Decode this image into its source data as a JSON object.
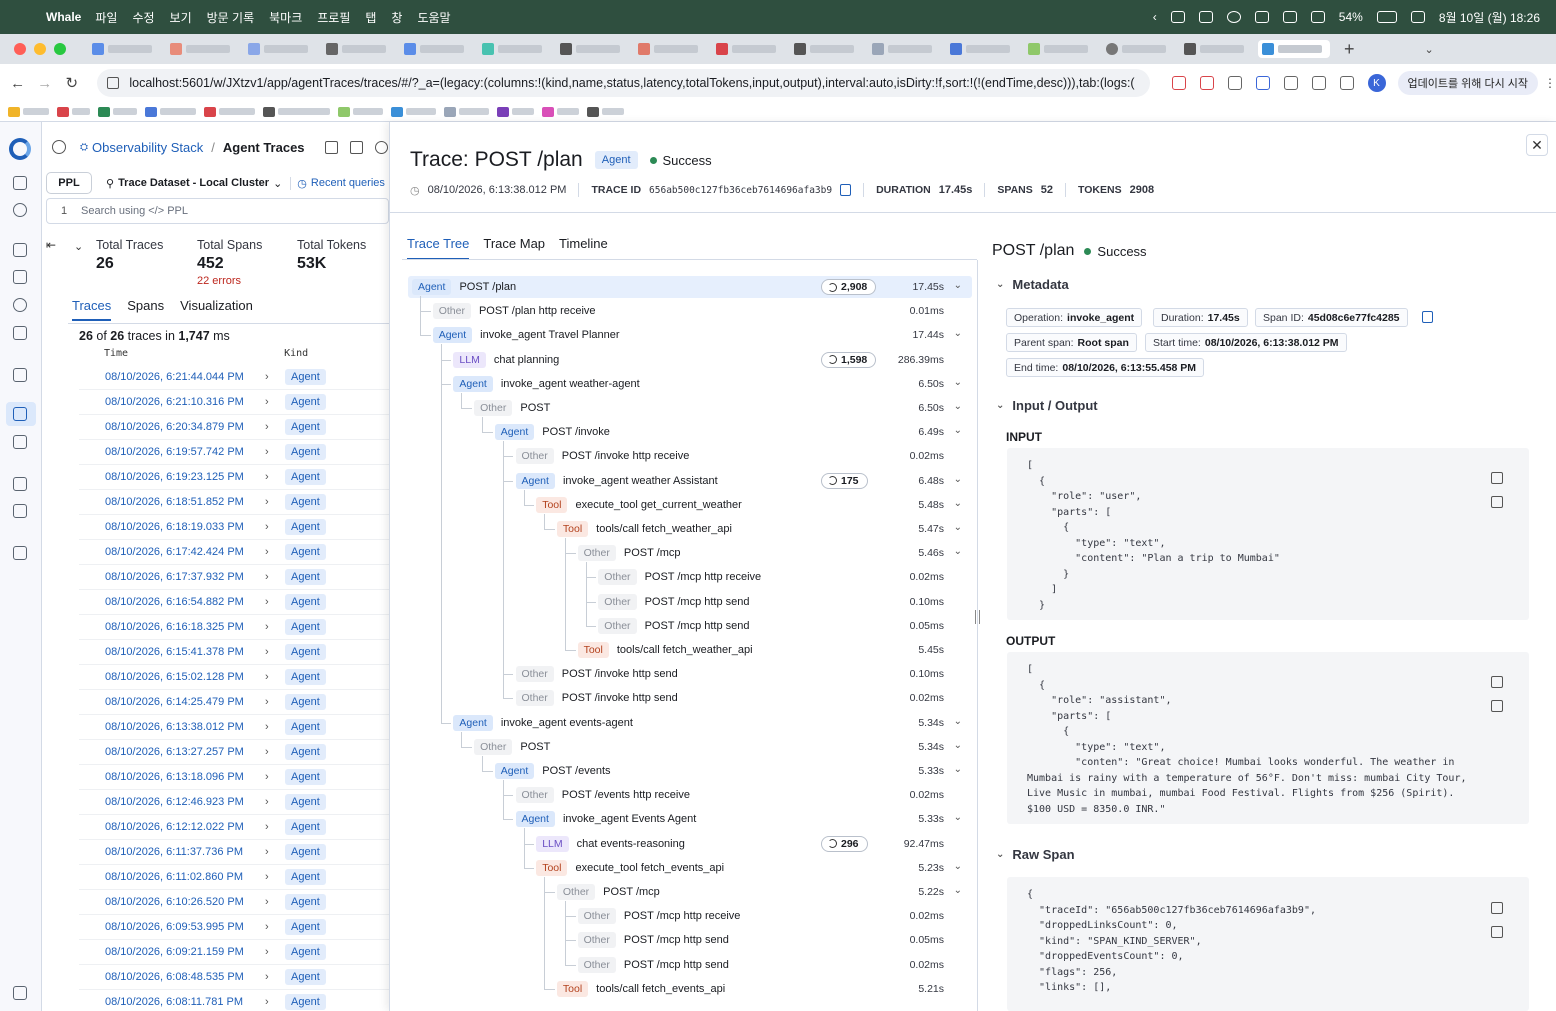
{
  "menubar": {
    "app": "Whale",
    "items": [
      "파일",
      "수정",
      "보기",
      "방문 기록",
      "북마크",
      "프로필",
      "탭",
      "창",
      "도움말"
    ],
    "battery": "54%",
    "datetime": "8월 10일 (월) 18:26"
  },
  "browser": {
    "url": "localhost:5601/w/JXtzv1/app/agentTraces/traces/#/?_a=(legacy:(columns:!(kind,name,status,latency,totalTokens,input,output),interval:auto,isDirty:!f,sort:!(!(endTime,desc))),tab:(logs:(",
    "update_button": "업데이트를 위해 다시 시작",
    "avatar_letter": "K"
  },
  "header": {
    "breadcrumb_parent": "Observability Stack",
    "breadcrumb_current": "Agent Traces"
  },
  "query": {
    "language": "PPL",
    "dataset": "Trace Dataset - Local Cluster",
    "recent": "Recent queries",
    "line_number": "1",
    "placeholder": "Search using </> PPL"
  },
  "summary": {
    "total_traces_label": "Total Traces",
    "total_traces": "26",
    "total_spans_label": "Total Spans",
    "total_spans": "452",
    "errors": "22 errors",
    "total_tokens_label": "Total Tokens",
    "total_tokens": "53K"
  },
  "left_tabs": [
    "Traces",
    "Spans",
    "Visualization"
  ],
  "count_prefix": "26",
  "count_mid": " of ",
  "count_total": "26",
  "count_suffix": " traces in ",
  "count_ms": "1,747",
  "count_unit": " ms",
  "columns": {
    "time": "Time",
    "kind": "Kind"
  },
  "traces": [
    "08/10/2026, 6:21:44.044 PM",
    "08/10/2026, 6:21:10.316 PM",
    "08/10/2026, 6:20:34.879 PM",
    "08/10/2026, 6:19:57.742 PM",
    "08/10/2026, 6:19:23.125 PM",
    "08/10/2026, 6:18:51.852 PM",
    "08/10/2026, 6:18:19.033 PM",
    "08/10/2026, 6:17:42.424 PM",
    "08/10/2026, 6:17:37.932 PM",
    "08/10/2026, 6:16:54.882 PM",
    "08/10/2026, 6:16:18.325 PM",
    "08/10/2026, 6:15:41.378 PM",
    "08/10/2026, 6:15:02.128 PM",
    "08/10/2026, 6:14:25.479 PM",
    "08/10/2026, 6:13:38.012 PM",
    "08/10/2026, 6:13:27.257 PM",
    "08/10/2026, 6:13:18.096 PM",
    "08/10/2026, 6:12:46.923 PM",
    "08/10/2026, 6:12:12.022 PM",
    "08/10/2026, 6:11:37.736 PM",
    "08/10/2026, 6:11:02.860 PM",
    "08/10/2026, 6:10:26.520 PM",
    "08/10/2026, 6:09:53.995 PM",
    "08/10/2026, 6:09:21.159 PM",
    "08/10/2026, 6:08:48.535 PM",
    "08/10/2026, 6:08:11.781 PM"
  ],
  "trace_kind": "Agent",
  "detail": {
    "title": "Trace: POST /plan",
    "kind": "Agent",
    "status": "Success",
    "timestamp": "08/10/2026, 6:13:38.012 PM",
    "trace_id_label": "TRACE ID",
    "trace_id": "656ab500c127fb36ceb7614696afa3b9",
    "duration_label": "DURATION",
    "duration": "17.45s",
    "spans_label": "SPANS",
    "spans": "52",
    "tokens_label": "TOKENS",
    "tokens": "2908"
  },
  "tree_tabs": [
    "Trace Tree",
    "Trace Map",
    "Timeline"
  ],
  "tree": [
    {
      "kind": "Agent",
      "name": "POST /plan",
      "tokens": "2,908",
      "dur": "17.45s",
      "exp": true
    },
    {
      "kind": "Other",
      "name": "POST /plan http receive",
      "tokens": "",
      "dur": "0.01ms",
      "exp": false
    },
    {
      "kind": "Agent",
      "name": "invoke_agent Travel Planner",
      "tokens": "",
      "dur": "17.44s",
      "exp": true
    },
    {
      "kind": "LLM",
      "name": "chat planning",
      "tokens": "1,598",
      "dur": "286.39ms",
      "exp": false
    },
    {
      "kind": "Agent",
      "name": "invoke_agent weather-agent",
      "tokens": "",
      "dur": "6.50s",
      "exp": true
    },
    {
      "kind": "Other",
      "name": "POST",
      "tokens": "",
      "dur": "6.50s",
      "exp": true
    },
    {
      "kind": "Agent",
      "name": "POST /invoke",
      "tokens": "",
      "dur": "6.49s",
      "exp": true
    },
    {
      "kind": "Other",
      "name": "POST /invoke http receive",
      "tokens": "",
      "dur": "0.02ms",
      "exp": false
    },
    {
      "kind": "Agent",
      "name": "invoke_agent weather Assistant",
      "tokens": "175",
      "dur": "6.48s",
      "exp": true
    },
    {
      "kind": "Tool",
      "name": "execute_tool get_current_weather",
      "tokens": "",
      "dur": "5.48s",
      "exp": true
    },
    {
      "kind": "Tool",
      "name": "tools/call fetch_weather_api",
      "tokens": "",
      "dur": "5.47s",
      "exp": true
    },
    {
      "kind": "Other",
      "name": "POST /mcp",
      "tokens": "",
      "dur": "5.46s",
      "exp": true
    },
    {
      "kind": "Other",
      "name": "POST /mcp http receive",
      "tokens": "",
      "dur": "0.02ms",
      "exp": false
    },
    {
      "kind": "Other",
      "name": "POST /mcp http send",
      "tokens": "",
      "dur": "0.10ms",
      "exp": false
    },
    {
      "kind": "Other",
      "name": "POST /mcp http send",
      "tokens": "",
      "dur": "0.05ms",
      "exp": false
    },
    {
      "kind": "Tool",
      "name": "tools/call fetch_weather_api",
      "tokens": "",
      "dur": "5.45s",
      "exp": false
    },
    {
      "kind": "Other",
      "name": "POST /invoke http send",
      "tokens": "",
      "dur": "0.10ms",
      "exp": false
    },
    {
      "kind": "Other",
      "name": "POST /invoke http send",
      "tokens": "",
      "dur": "0.02ms",
      "exp": false
    },
    {
      "kind": "Agent",
      "name": "invoke_agent events-agent",
      "tokens": "",
      "dur": "5.34s",
      "exp": true
    },
    {
      "kind": "Other",
      "name": "POST",
      "tokens": "",
      "dur": "5.34s",
      "exp": true
    },
    {
      "kind": "Agent",
      "name": "POST /events",
      "tokens": "",
      "dur": "5.33s",
      "exp": true
    },
    {
      "kind": "Other",
      "name": "POST /events http receive",
      "tokens": "",
      "dur": "0.02ms",
      "exp": false
    },
    {
      "kind": "Agent",
      "name": "invoke_agent Events Agent",
      "tokens": "",
      "dur": "5.33s",
      "exp": true
    },
    {
      "kind": "LLM",
      "name": "chat events-reasoning",
      "tokens": "296",
      "dur": "92.47ms",
      "exp": false
    },
    {
      "kind": "Tool",
      "name": "execute_tool fetch_events_api",
      "tokens": "",
      "dur": "5.23s",
      "exp": true
    },
    {
      "kind": "Other",
      "name": "POST /mcp",
      "tokens": "",
      "dur": "5.22s",
      "exp": true
    },
    {
      "kind": "Other",
      "name": "POST /mcp http receive",
      "tokens": "",
      "dur": "0.02ms",
      "exp": false
    },
    {
      "kind": "Other",
      "name": "POST /mcp http send",
      "tokens": "",
      "dur": "0.05ms",
      "exp": false
    },
    {
      "kind": "Other",
      "name": "POST /mcp http send",
      "tokens": "",
      "dur": "0.02ms",
      "exp": false
    },
    {
      "kind": "Tool",
      "name": "tools/call fetch_events_api",
      "tokens": "",
      "dur": "5.21s",
      "exp": false
    }
  ],
  "span": {
    "title": "POST /plan",
    "status": "Success",
    "metadata_label": "Metadata",
    "operation_label": "Operation:",
    "operation": "invoke_agent",
    "duration_label": "Duration:",
    "duration": "17.45s",
    "span_id_label": "Span ID:",
    "span_id": "45d08c6e77fc4285",
    "parent_label": "Parent span:",
    "parent": "Root span",
    "start_label": "Start time:",
    "start": "08/10/2026, 6:13:38.012 PM",
    "end_label": "End time:",
    "end": "08/10/2026, 6:13:55.458 PM",
    "io_label": "Input / Output",
    "input_label": "INPUT",
    "output_label": "OUTPUT",
    "raw_label": "Raw Span",
    "input_code": "[\n  {\n    \"role\": \"user\",\n    \"parts\": [\n      {\n        \"type\": \"text\",\n        \"content\": \"Plan a trip to Mumbai\"\n      }\n    ]\n  }",
    "output_code": "[\n  {\n    \"role\": \"assistant\",\n    \"parts\": [\n      {\n        \"type\": \"text\",\n        \"conten\": \"Great choice! Mumbai looks wonderful. The weather in\nMumbai is rainy with a temperature of 56°F. Don't miss: mumbai City Tour,\nLive Music in mumbai, mumbai Food Festival. Flights from $256 (Spirit).\n$100 USD = 8350.0 INR.\"",
    "raw_code": "{\n  \"traceId\": \"656ab500c127fb36ceb7614696afa3b9\",\n  \"droppedLinksCount\": 0,\n  \"kind\": \"SPAN_KIND_SERVER\",\n  \"droppedEventsCount\": 0,\n  \"flags\": 256,\n  \"links\": [],"
  }
}
